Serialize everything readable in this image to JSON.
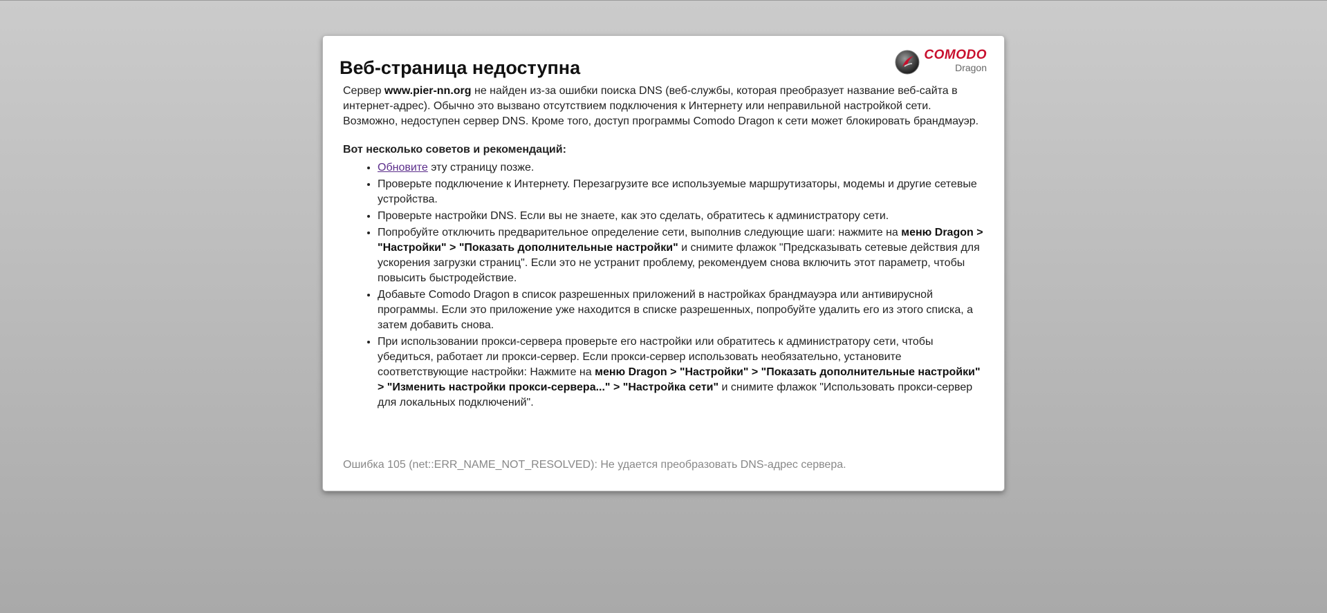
{
  "page": {
    "title": "Веб-страница недоступна",
    "logo": {
      "brand": "COMODO",
      "sub": "Dragon",
      "brand_color": "#c8102e"
    },
    "description": {
      "prefix": "Сервер ",
      "host": "www.pier-nn.org",
      "suffix": " не найден из-за ошибки поиска DNS (веб-службы, которая преобразует название веб-сайта в интернет-адрес). Обычно это вызвано отсутствием подключения к Интернету или неправильной настройкой сети. Возможно, недоступен сервер DNS. Кроме того, доступ программы Comodo Dragon к сети может блокировать брандмауэр."
    },
    "tips_heading": "Вот несколько советов и рекомендаций:",
    "tips": {
      "reload": {
        "link": "Обновите",
        "rest": " эту страницу позже."
      },
      "connection": "Проверьте подключение к Интернету. Перезагрузите все используемые маршрутизаторы, модемы и другие сетевые устройства.",
      "dns": "Проверьте настройки DNS. Если вы не знаете, как это сделать, обратитесь к администратору сети.",
      "prediction": {
        "p1": "Попробуйте отключить предварительное определение сети, выполнив следующие шаги: нажмите на ",
        "b1": "меню Dragon > \"Настройки\" > \"Показать дополнительные настройки\"",
        "p2": " и снимите флажок \"Предсказывать сетевые действия для ускорения загрузки страниц\". Если это не устранит проблему, рекомендуем снова включить этот параметр, чтобы повысить быстродействие."
      },
      "firewall": "Добавьте Comodo Dragon в список разрешенных приложений в настройках брандмауэра или антивирусной программы. Если это приложение уже находится в списке разрешенных, попробуйте удалить его из этого списка, а затем добавить снова.",
      "proxy": {
        "p1": "При использовании прокси-сервера проверьте его настройки или обратитесь к администратору сети, чтобы убедиться, работает ли прокси-сервер. Если прокси-сервер использовать необязательно, установите соответствующие настройки: Нажмите на ",
        "b1": "меню Dragon > \"Настройки\" > \"Показать дополнительные настройки\" > \"Изменить настройки прокси-сервера...\" > \"Настройка сети\"",
        "p2": " и снимите флажок \"Использовать прокси-сервер для локальных подключений\"."
      }
    },
    "error_code": "Ошибка 105 (net::ERR_NAME_NOT_RESOLVED): Не удается преобразовать DNS-адрес сервера."
  }
}
